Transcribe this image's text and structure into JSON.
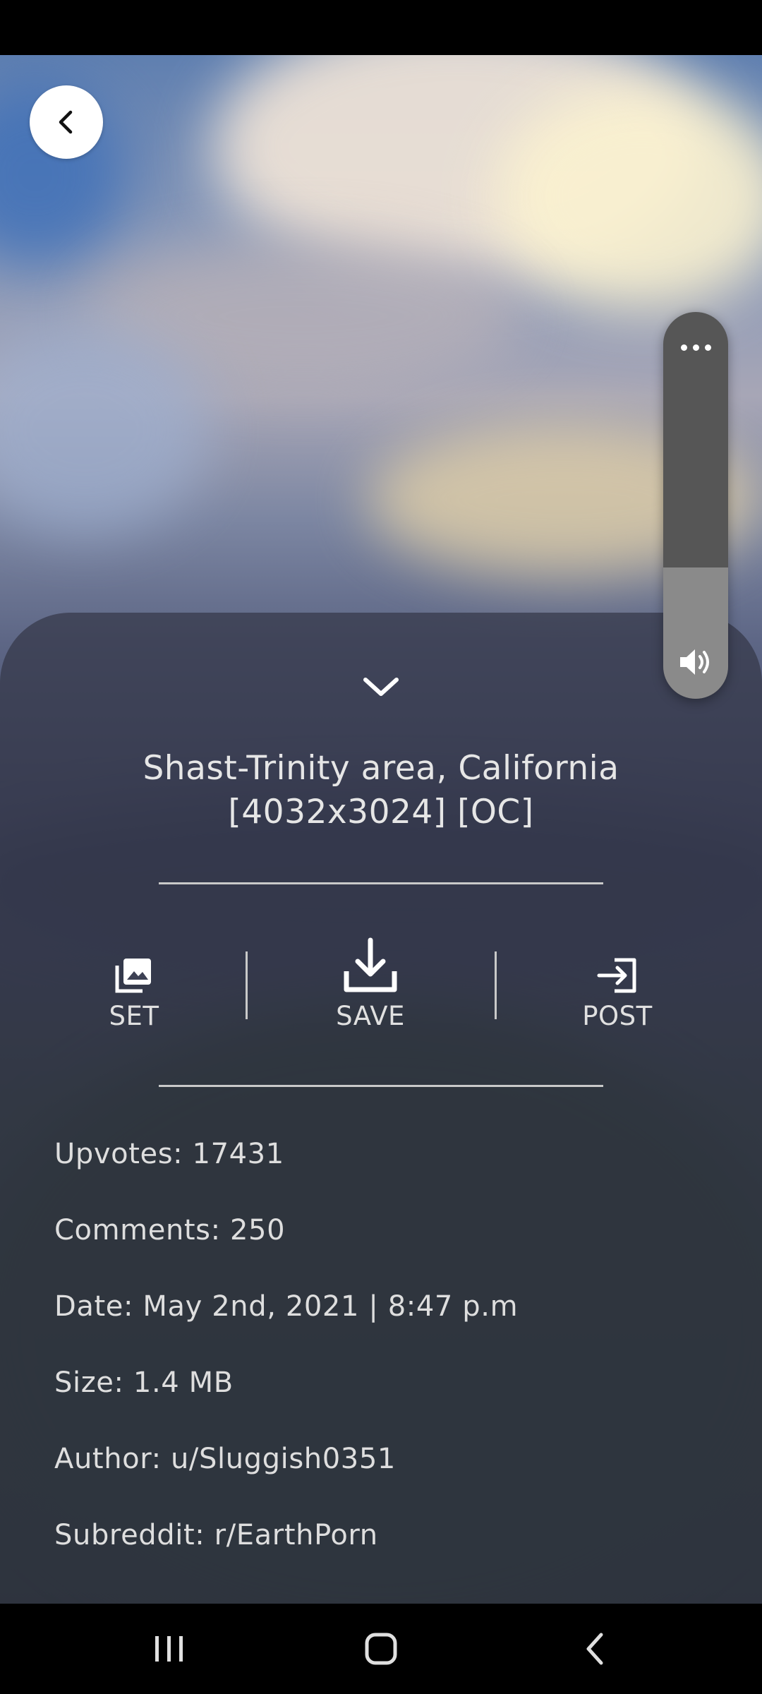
{
  "post": {
    "title": "Shast-Trinity area, California [4032x3024] [OC]"
  },
  "actions": [
    {
      "label": "SET",
      "icon": "wallpaper-image-icon"
    },
    {
      "label": "SAVE",
      "icon": "download-icon"
    },
    {
      "label": "POST",
      "icon": "open-post-icon"
    }
  ],
  "info": {
    "upvotes": "Upvotes: 17431",
    "comments": "Comments: 250",
    "date": "Date: May 2nd, 2021 | 8:47 p.m",
    "size": "Size: 1.4 MB",
    "author": "Author: u/Sluggish0351",
    "subreddit": "Subreddit: r/EarthPorn"
  },
  "volume": {
    "level": 0.34,
    "icons": [
      "more-options-icon",
      "speaker-icon"
    ]
  },
  "navigation": {
    "icons": [
      "back-arrow-icon",
      "chevron-down-icon",
      "recent-apps-icon",
      "home-icon",
      "system-back-icon"
    ]
  },
  "colors": {
    "sheet": "#343848",
    "text": "#e6e6e6",
    "divider": "#c9c9c9"
  }
}
